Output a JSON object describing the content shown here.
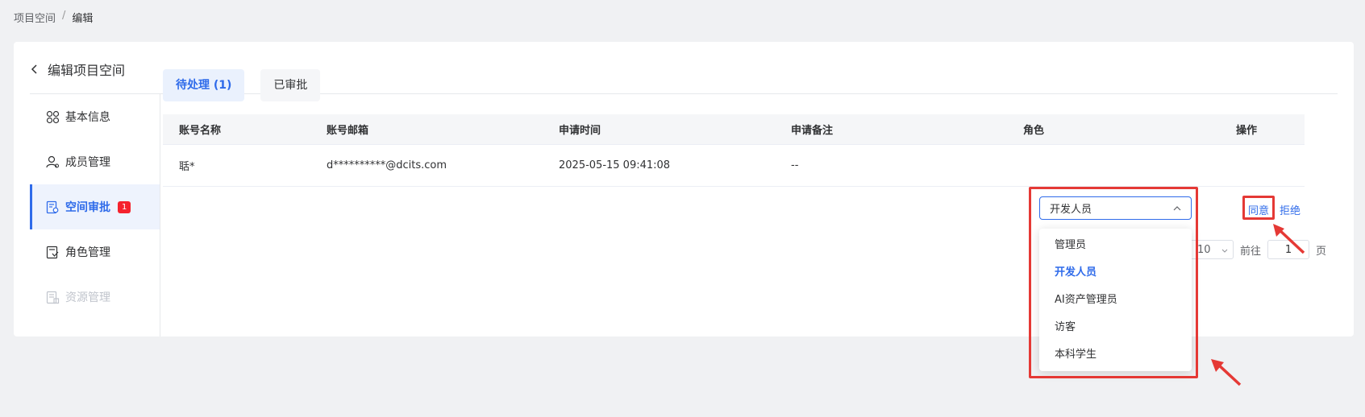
{
  "breadcrumb": {
    "parent": "项目空间",
    "separator": "/",
    "current": "编辑"
  },
  "page": {
    "title": "编辑项目空间"
  },
  "sidebar": {
    "items": [
      {
        "label": "基本信息",
        "icon": "grid-icon"
      },
      {
        "label": "成员管理",
        "icon": "user-icon"
      },
      {
        "label": "空间审批",
        "icon": "approval-icon",
        "badge": "1",
        "active": true
      },
      {
        "label": "角色管理",
        "icon": "role-icon"
      },
      {
        "label": "资源管理",
        "icon": "resource-icon",
        "disabled": true
      }
    ]
  },
  "tabs": [
    {
      "label": "待处理 (1)",
      "active": true
    },
    {
      "label": "已审批"
    }
  ],
  "table": {
    "headers": [
      "账号名称",
      "账号邮箱",
      "申请时间",
      "申请备注",
      "角色",
      "操作"
    ],
    "rows": [
      {
        "name": "聒*",
        "email": "d**********@dcits.com",
        "time": "2025-05-15 09:41:08",
        "note": "--",
        "role": "开发人员",
        "agree": "同意",
        "reject": "拒绝"
      }
    ]
  },
  "role_dropdown": {
    "selected": "开发人员",
    "options": [
      "管理员",
      "开发人员",
      "AI资产管理员",
      "访客",
      "本科学生"
    ]
  },
  "pagination": {
    "page_size": "10",
    "goto_label": "前往",
    "goto_value": "1",
    "page_unit": "页"
  },
  "colors": {
    "accent": "#2f6bea",
    "highlight": "#e53935",
    "badge": "#f5222d"
  }
}
